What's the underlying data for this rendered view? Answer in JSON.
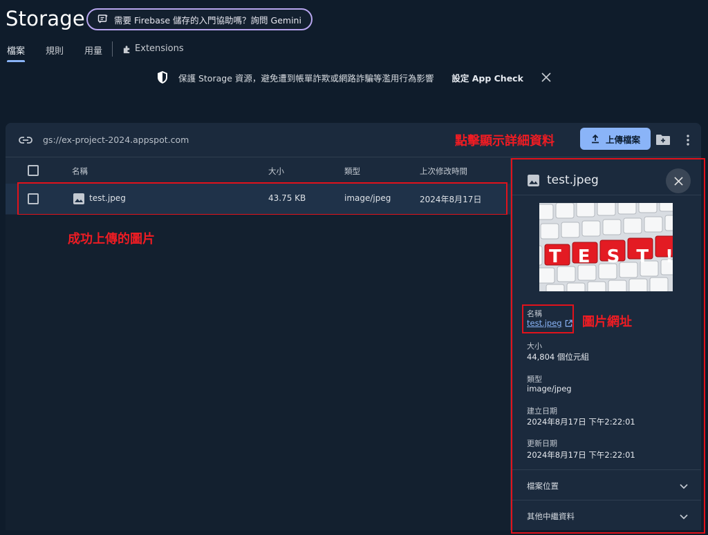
{
  "header": {
    "title": "Storage",
    "gemini_prompt": "需要 Firebase 儲存的入門協助嗎？詢問 Gemini"
  },
  "tabs": [
    {
      "label": "檔案",
      "active": true
    },
    {
      "label": "規則",
      "active": false
    },
    {
      "label": "用量",
      "active": false
    },
    {
      "label": "Extensions",
      "active": false
    }
  ],
  "banner": {
    "message": "保護 Storage 資源，避免遭到帳單詐欺或網路詐騙等濫用行為影響",
    "action": "設定 App Check"
  },
  "bucket": {
    "path": "gs://ex-project-2024.appspot.com",
    "upload_label": "上傳檔案"
  },
  "table": {
    "columns": [
      "名稱",
      "大小",
      "類型",
      "上次修改時間"
    ],
    "rows": [
      {
        "name": "test.jpeg",
        "size": "43.75 KB",
        "type": "image/jpeg",
        "modified": "2024年8月17日"
      }
    ]
  },
  "annotations": {
    "click_detail": "點擊顯示詳細資料",
    "uploaded": "成功上傳的圖片",
    "image_url": "圖片網址"
  },
  "panel": {
    "title": "test.jpeg",
    "thumb_text": "TEST!",
    "name_label": "名稱",
    "name_value": "test.jpeg",
    "size_label": "大小",
    "size_value": "44,804 個位元組",
    "type_label": "類型",
    "type_value": "image/jpeg",
    "created_label": "建立日期",
    "created_value": "2024年8月17日 下午2:22:01",
    "updated_label": "更新日期",
    "updated_value": "2024年8月17日 下午2:22:01",
    "accordion_location": "檔案位置",
    "accordion_metadata": "其他中繼資料"
  },
  "colors": {
    "accent": "#8ab4f8",
    "annotation_red": "#e2121b",
    "background": "#0f1c2b",
    "card": "#1b2a3d"
  }
}
